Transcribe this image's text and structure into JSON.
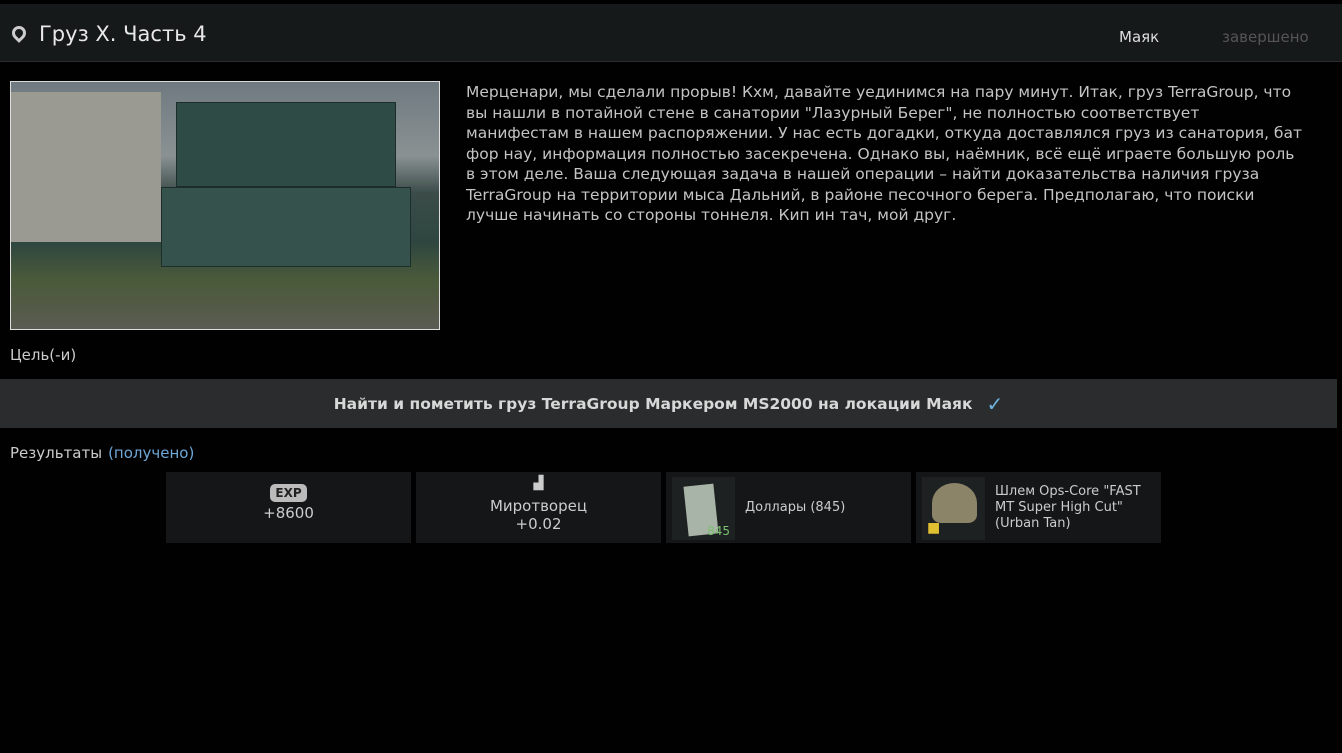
{
  "header": {
    "title": "Груз X. Часть 4",
    "location": "Маяк",
    "status": "завершено"
  },
  "description": "Мерценари, мы сделали прорыв! Кхм, давайте уединимся на пару минут. Итак, груз TerraGroup, что вы нашли в потайной стене в санатории \"Лазурный Берег\", не полностью соответствует манифестам в нашем распоряжении. У нас есть догадки, откуда доставлялся груз из санатория, бат фор нау, информация полностью засекречена. Однако вы, наёмник, всё ещё играете большую роль в этом деле. Ваша следующая задача в нашей операции – найти доказательства наличия груза TerraGroup на территории мыса Дальний, в районе песочного берега. Предполагаю, что поиски лучше начинать со стороны тоннеля. Кип ин тач, мой друг.",
  "goals_label": "Цель(-и)",
  "objective": "Найти и пометить груз TerraGroup Маркером MS2000 на локации Маяк",
  "results": {
    "label": "Результаты",
    "state": "(получено)",
    "exp": {
      "badge": "EXP",
      "value": "+8600"
    },
    "rep": {
      "trader": "Миротворец",
      "value": "+0.02"
    },
    "money": {
      "name": "Доллары (845)",
      "count": "845"
    },
    "helmet": {
      "name": "Шлем Ops-Core \"FAST MT Super High Cut\" (Urban Tan)"
    }
  }
}
